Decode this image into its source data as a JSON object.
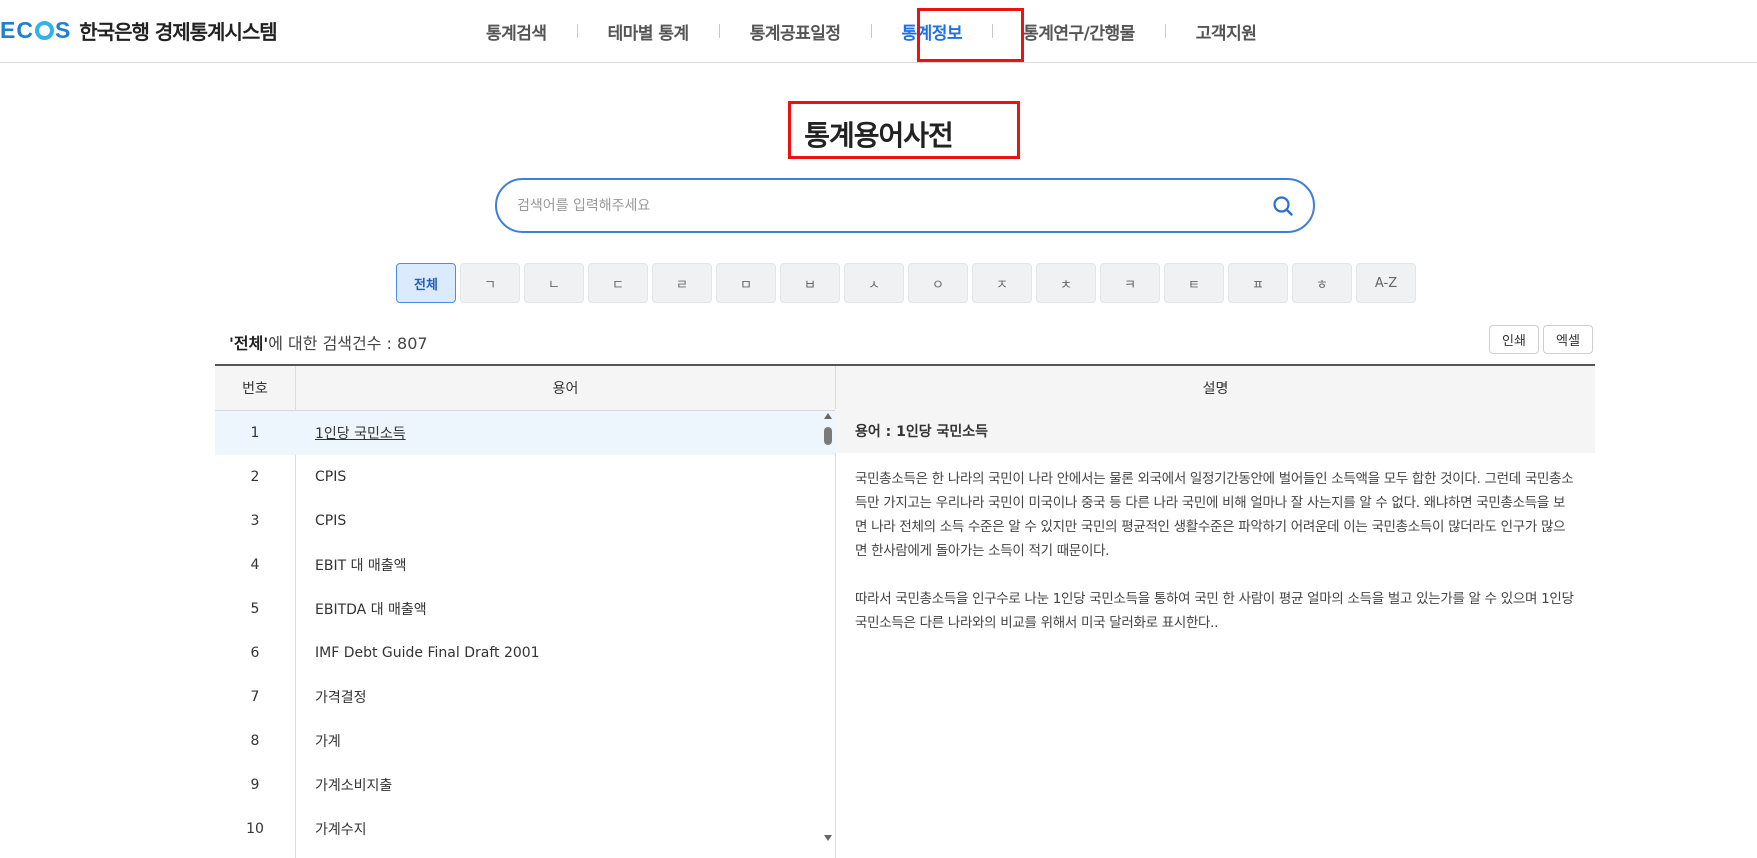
{
  "header": {
    "logo_mark": "EC",
    "logo_mark_end": "S",
    "logo_text": "한국은행 경제통계시스템",
    "nav": [
      {
        "label": "통계검색"
      },
      {
        "label": "테마별 통계"
      },
      {
        "label": "통계공표일정"
      },
      {
        "label": "통계정보",
        "active": true
      },
      {
        "label": "통계연구/간행물"
      },
      {
        "label": "고객지원"
      }
    ],
    "active_color": "#1a73e8"
  },
  "page": {
    "title": "통계용어사전"
  },
  "search": {
    "placeholder": "검색어를 입력해주세요",
    "value": "",
    "icon": "search-icon"
  },
  "index_filters": [
    {
      "label": "전체",
      "active": true
    },
    {
      "label": "ㄱ"
    },
    {
      "label": "ㄴ"
    },
    {
      "label": "ㄷ"
    },
    {
      "label": "ㄹ"
    },
    {
      "label": "ㅁ"
    },
    {
      "label": "ㅂ"
    },
    {
      "label": "ㅅ"
    },
    {
      "label": "ㅇ"
    },
    {
      "label": "ㅈ"
    },
    {
      "label": "ㅊ"
    },
    {
      "label": "ㅋ"
    },
    {
      "label": "ㅌ"
    },
    {
      "label": "ㅍ"
    },
    {
      "label": "ㅎ"
    },
    {
      "label": "A-Z"
    }
  ],
  "summary": {
    "quoted_term": "'전체'",
    "suffix": "에 대한 검색건수 : 807"
  },
  "actions": {
    "print_label": "인쇄",
    "excel_label": "엑셀"
  },
  "table": {
    "headers": {
      "number": "번호",
      "term": "용어",
      "description": "설명"
    },
    "rows": [
      {
        "num": "1",
        "term": "1인당 국민소득",
        "selected": true
      },
      {
        "num": "2",
        "term": "CPIS"
      },
      {
        "num": "3",
        "term": "CPIS"
      },
      {
        "num": "4",
        "term": "EBIT 대 매출액"
      },
      {
        "num": "5",
        "term": "EBITDA 대 매출액"
      },
      {
        "num": "6",
        "term": "IMF Debt Guide Final Draft 2001"
      },
      {
        "num": "7",
        "term": "가격결정"
      },
      {
        "num": "8",
        "term": "가계"
      },
      {
        "num": "9",
        "term": "가계소비지출"
      },
      {
        "num": "10",
        "term": "가계수지"
      }
    ]
  },
  "description": {
    "heading": "용어 : 1인당 국민소득",
    "paragraphs": [
      "국민총소득은 한 나라의 국민이 나라 안에서는 물론 외국에서 일정기간동안에 벌어들인 소득액을 모두 합한 것이다. 그런데 국민총소득만  가지고는 우리나라 국민이 미국이나 중국 등 다른 나라 국민에 비해 얼마나 잘 사는지를 알 수 없다. 왜냐하면 국민총소득을 보면 나라 전체의 소득 수준은 알 수 있지만 국민의 평균적인 생활수준은 파악하기 어려운데 이는 국민총소득이 많더라도 인구가 많으면 한사람에게 돌아가는 소득이 적기 때문이다.",
      "따라서 국민총소득을 인구수로 나눈 1인당 국민소득을 통하여 국민 한 사람이 평균 얼마의 소득을 벌고 있는가를 알 수 있으며 1인당 국민소득은 다른 나라와의 비교를 위해서 미국 달러화로 표시한다.."
    ]
  }
}
